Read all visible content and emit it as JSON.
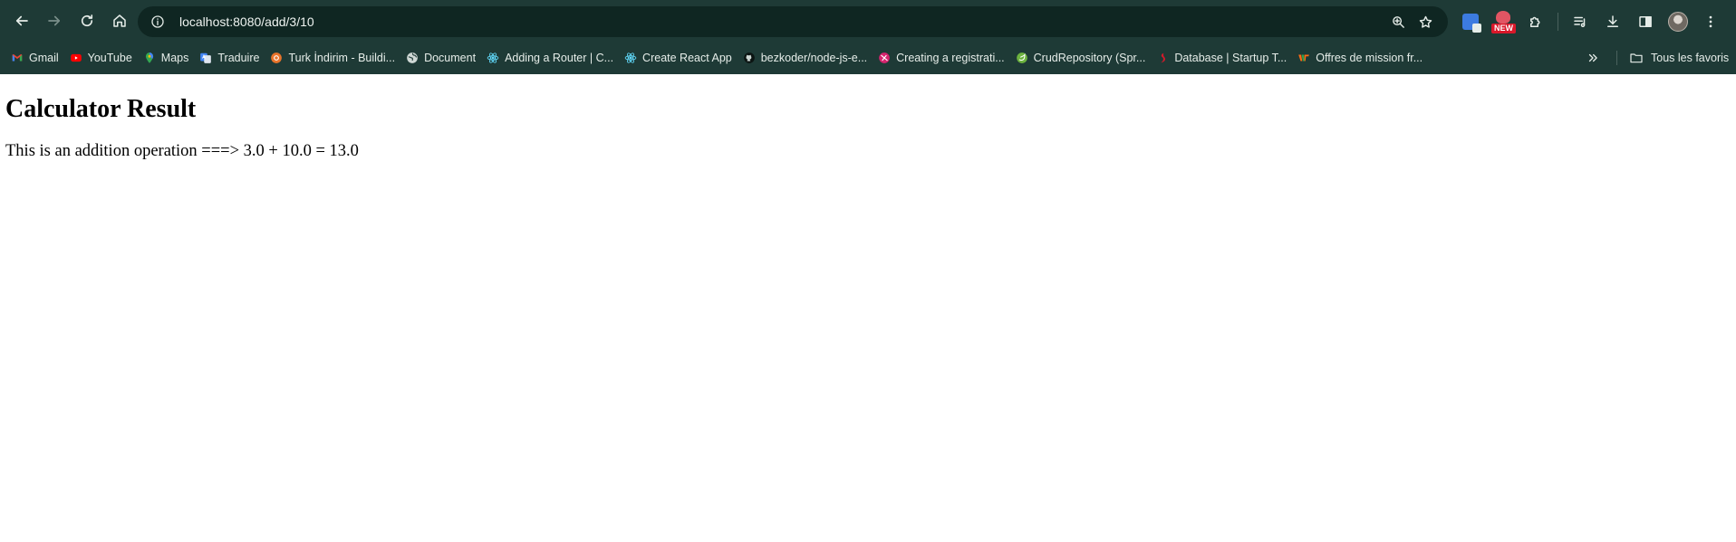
{
  "browser": {
    "url": "localhost:8080/add/3/10",
    "extension_badge": "NEW",
    "colors": {
      "frame": "#1e3a36",
      "omnibox": "#0f2622",
      "text": "#e6ede9"
    }
  },
  "bookmarks": {
    "items": [
      {
        "label": "Gmail",
        "icon": "gmail-icon"
      },
      {
        "label": "YouTube",
        "icon": "youtube-icon"
      },
      {
        "label": "Maps",
        "icon": "maps-icon"
      },
      {
        "label": "Traduire",
        "icon": "translate-icon"
      },
      {
        "label": "Turk İndirim - Buildi...",
        "icon": "site-icon"
      },
      {
        "label": "Document",
        "icon": "globe-icon"
      },
      {
        "label": "Adding a Router | C...",
        "icon": "react-icon"
      },
      {
        "label": "Create React App",
        "icon": "react-icon"
      },
      {
        "label": "bezkoder/node-js-e...",
        "icon": "github-icon"
      },
      {
        "label": "Creating a registrati...",
        "icon": "site-icon"
      },
      {
        "label": "CrudRepository (Spr...",
        "icon": "spring-icon"
      },
      {
        "label": "Database | Startup T...",
        "icon": "site-icon"
      },
      {
        "label": "Offres de mission fr...",
        "icon": "site-icon"
      }
    ],
    "all_bookmarks_label": "Tous les favoris"
  },
  "page": {
    "heading": "Calculator Result",
    "message": "This is an addition operation ===> 3.0 + 10.0 = 13.0"
  }
}
